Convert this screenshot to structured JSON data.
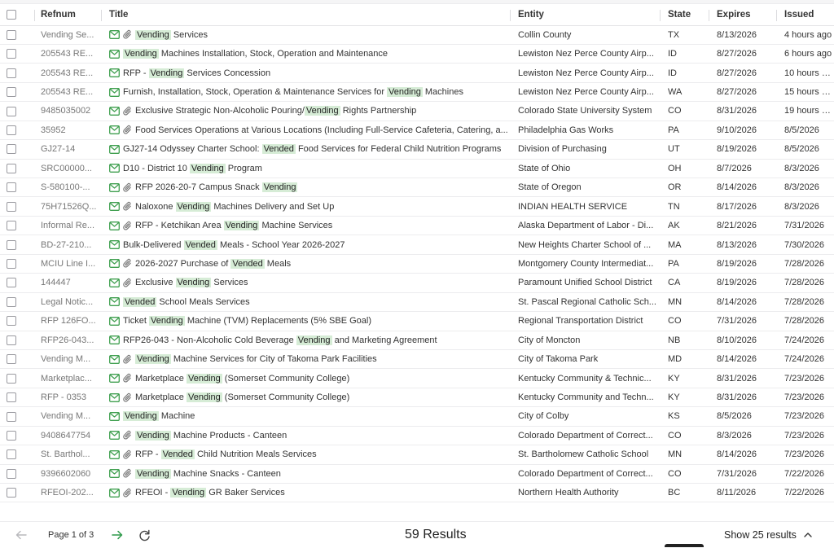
{
  "table": {
    "headers": {
      "refnum": "Refnum",
      "title": "Title",
      "entity": "Entity",
      "state": "State",
      "expires": "Expires",
      "issued": "Issued"
    },
    "rows": [
      {
        "ref": "Vending Se...",
        "clip": true,
        "title": [
          {
            "t": "Vending",
            "h": true
          },
          {
            "t": " Services"
          }
        ],
        "entity": "Collin County",
        "state": "TX",
        "expires": "8/13/2026",
        "issued": "4 hours ago"
      },
      {
        "ref": "205543 RE...",
        "clip": false,
        "title": [
          {
            "t": "Vending",
            "h": true
          },
          {
            "t": " Machines Installation, Stock, Operation and Maintenance"
          }
        ],
        "entity": "Lewiston Nez Perce County Airp...",
        "state": "ID",
        "expires": "8/27/2026",
        "issued": "6 hours ago"
      },
      {
        "ref": "205543 RE...",
        "clip": false,
        "title": [
          {
            "t": "RFP - "
          },
          {
            "t": "Vending",
            "h": true
          },
          {
            "t": " Services Concession"
          }
        ],
        "entity": "Lewiston Nez Perce County Airp...",
        "state": "ID",
        "expires": "8/27/2026",
        "issued": "10 hours ago"
      },
      {
        "ref": "205543 RE...",
        "clip": false,
        "title": [
          {
            "t": "Furnish, Installation, Stock, Operation & Maintenance Services for "
          },
          {
            "t": "Vending",
            "h": true
          },
          {
            "t": " Machines"
          }
        ],
        "entity": "Lewiston Nez Perce County Airp...",
        "state": "WA",
        "expires": "8/27/2026",
        "issued": "15 hours ago"
      },
      {
        "ref": "9485035002",
        "clip": true,
        "title": [
          {
            "t": "Exclusive Strategic Non-Alcoholic Pouring/"
          },
          {
            "t": "Vending",
            "h": true
          },
          {
            "t": " Rights Partnership"
          }
        ],
        "entity": "Colorado State University System",
        "state": "CO",
        "expires": "8/31/2026",
        "issued": "19 hours ago"
      },
      {
        "ref": "35952",
        "clip": true,
        "title": [
          {
            "t": "Food Services Operations at Various Locations (Including Full-Service Cafeteria, Catering, a..."
          }
        ],
        "entity": "Philadelphia Gas Works",
        "state": "PA",
        "expires": "9/10/2026",
        "issued": "8/5/2026"
      },
      {
        "ref": "GJ27-14",
        "clip": false,
        "title": [
          {
            "t": "GJ27-14 Odyssey Charter School: "
          },
          {
            "t": "Vended",
            "h": true
          },
          {
            "t": " Food Services for Federal Child Nutrition Programs"
          }
        ],
        "entity": "Division of Purchasing",
        "state": "UT",
        "expires": "8/19/2026",
        "issued": "8/5/2026"
      },
      {
        "ref": "SRC00000...",
        "clip": false,
        "title": [
          {
            "t": "D10 - District 10 "
          },
          {
            "t": "Vending",
            "h": true
          },
          {
            "t": " Program"
          }
        ],
        "entity": "State of Ohio",
        "state": "OH",
        "expires": "8/7/2026",
        "issued": "8/3/2026"
      },
      {
        "ref": "S-580100-...",
        "clip": true,
        "title": [
          {
            "t": "RFP 2026-20-7 Campus Snack "
          },
          {
            "t": "Vending",
            "h": true
          }
        ],
        "entity": "State of Oregon",
        "state": "OR",
        "expires": "8/14/2026",
        "issued": "8/3/2026"
      },
      {
        "ref": "75H71526Q...",
        "clip": true,
        "title": [
          {
            "t": "Naloxone "
          },
          {
            "t": "Vending",
            "h": true
          },
          {
            "t": " Machines Delivery and Set Up"
          }
        ],
        "entity": "INDIAN HEALTH SERVICE",
        "state": "TN",
        "expires": "8/17/2026",
        "issued": "8/3/2026"
      },
      {
        "ref": "Informal Re...",
        "clip": true,
        "title": [
          {
            "t": "RFP - Ketchikan Area "
          },
          {
            "t": "Vending",
            "h": true
          },
          {
            "t": " Machine Services"
          }
        ],
        "entity": "Alaska Department of Labor - Di...",
        "state": "AK",
        "expires": "8/21/2026",
        "issued": "7/31/2026"
      },
      {
        "ref": "BD-27-210...",
        "clip": false,
        "title": [
          {
            "t": "Bulk-Delivered "
          },
          {
            "t": "Vended",
            "h": true
          },
          {
            "t": " Meals - School Year 2026-2027"
          }
        ],
        "entity": "New Heights Charter School of ...",
        "state": "MA",
        "expires": "8/13/2026",
        "issued": "7/30/2026"
      },
      {
        "ref": "MCIU Line I...",
        "clip": true,
        "title": [
          {
            "t": "2026-2027 Purchase of "
          },
          {
            "t": "Vended",
            "h": true
          },
          {
            "t": " Meals"
          }
        ],
        "entity": "Montgomery County Intermediat...",
        "state": "PA",
        "expires": "8/19/2026",
        "issued": "7/28/2026"
      },
      {
        "ref": "144447",
        "clip": true,
        "title": [
          {
            "t": "Exclusive "
          },
          {
            "t": "Vending",
            "h": true
          },
          {
            "t": " Services"
          }
        ],
        "entity": "Paramount Unified School District",
        "state": "CA",
        "expires": "8/19/2026",
        "issued": "7/28/2026"
      },
      {
        "ref": "Legal Notic...",
        "clip": false,
        "title": [
          {
            "t": "Vended",
            "h": true
          },
          {
            "t": " School Meals Services"
          }
        ],
        "entity": "St. Pascal Regional Catholic Sch...",
        "state": "MN",
        "expires": "8/14/2026",
        "issued": "7/28/2026"
      },
      {
        "ref": "RFP 126FO...",
        "clip": false,
        "title": [
          {
            "t": "Ticket "
          },
          {
            "t": "Vending",
            "h": true
          },
          {
            "t": " Machine (TVM) Replacements (5% SBE Goal)"
          }
        ],
        "entity": "Regional Transportation District",
        "state": "CO",
        "expires": "7/31/2026",
        "issued": "7/28/2026"
      },
      {
        "ref": "RFP26-043...",
        "clip": false,
        "title": [
          {
            "t": "RFP26-043 - Non-Alcoholic Cold Beverage "
          },
          {
            "t": "Vending",
            "h": true
          },
          {
            "t": " and Marketing Agreement"
          }
        ],
        "entity": "City of Moncton",
        "state": "NB",
        "expires": "8/10/2026",
        "issued": "7/24/2026"
      },
      {
        "ref": "Vending M...",
        "clip": true,
        "title": [
          {
            "t": "Vending",
            "h": true
          },
          {
            "t": " Machine Services for City of Takoma Park Facilities"
          }
        ],
        "entity": "City of Takoma Park",
        "state": "MD",
        "expires": "8/14/2026",
        "issued": "7/24/2026"
      },
      {
        "ref": "Marketplac...",
        "clip": true,
        "title": [
          {
            "t": "Marketplace "
          },
          {
            "t": "Vending",
            "h": true
          },
          {
            "t": " (Somerset Community College)"
          }
        ],
        "entity": "Kentucky Community & Technic...",
        "state": "KY",
        "expires": "8/31/2026",
        "issued": "7/23/2026"
      },
      {
        "ref": "RFP - 0353",
        "clip": true,
        "title": [
          {
            "t": "Marketplace "
          },
          {
            "t": "Vending",
            "h": true
          },
          {
            "t": " (Somerset Community College)"
          }
        ],
        "entity": "Kentucky Community and Techn...",
        "state": "KY",
        "expires": "8/31/2026",
        "issued": "7/23/2026"
      },
      {
        "ref": "Vending M...",
        "clip": false,
        "title": [
          {
            "t": "Vending",
            "h": true
          },
          {
            "t": " Machine"
          }
        ],
        "entity": "City of Colby",
        "state": "KS",
        "expires": "8/5/2026",
        "issued": "7/23/2026"
      },
      {
        "ref": "9408647754",
        "clip": true,
        "title": [
          {
            "t": "Vending",
            "h": true
          },
          {
            "t": " Machine Products - Canteen"
          }
        ],
        "entity": "Colorado Department of Correct...",
        "state": "CO",
        "expires": "8/3/2026",
        "issued": "7/23/2026"
      },
      {
        "ref": "St. Barthol...",
        "clip": true,
        "title": [
          {
            "t": "RFP - "
          },
          {
            "t": "Vended",
            "h": true
          },
          {
            "t": " Child Nutrition Meals Services"
          }
        ],
        "entity": "St. Bartholomew Catholic School",
        "state": "MN",
        "expires": "8/14/2026",
        "issued": "7/23/2026"
      },
      {
        "ref": "9396602060",
        "clip": true,
        "title": [
          {
            "t": "Vending",
            "h": true
          },
          {
            "t": " Machine Snacks - Canteen"
          }
        ],
        "entity": "Colorado Department of Correct...",
        "state": "CO",
        "expires": "7/31/2026",
        "issued": "7/22/2026"
      },
      {
        "ref": "RFEOI-202...",
        "clip": true,
        "title": [
          {
            "t": "RFEOI - "
          },
          {
            "t": "Vending",
            "h": true
          },
          {
            "t": " GR Baker Services"
          }
        ],
        "entity": "Northern Health Authority",
        "state": "BC",
        "expires": "8/11/2026",
        "issued": "7/22/2026"
      }
    ]
  },
  "footer": {
    "page_label": "Page 1 of 3",
    "results_label": "59 Results",
    "show_label": "Show 25 results"
  },
  "icons": {
    "mail": "mail-icon",
    "attachment": "paperclip-icon",
    "prev": "arrow-left-icon",
    "next": "arrow-right-icon",
    "refresh": "refresh-icon",
    "dropdown": "chevron-up-icon"
  },
  "colors": {
    "highlight": "#d6ecd6",
    "icon_green": "#3f9f4f",
    "next_arrow": "#2f9a4a"
  }
}
